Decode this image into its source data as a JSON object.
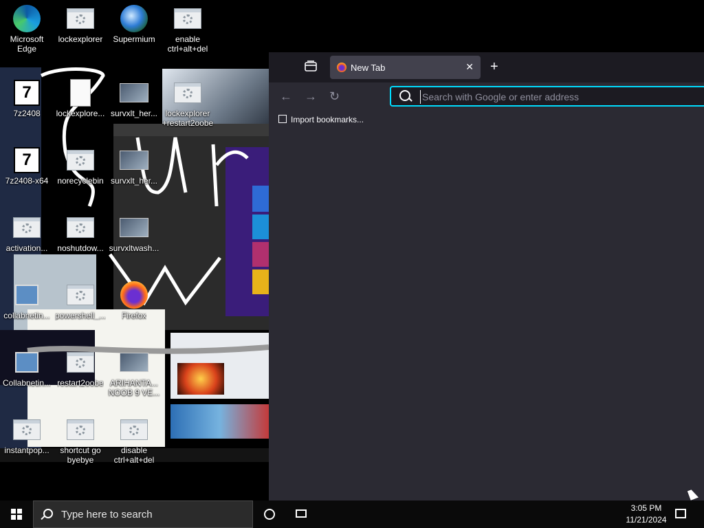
{
  "desktop": {
    "icons": [
      {
        "label": "Microsoft Edge"
      },
      {
        "label": "lockexplorer"
      },
      {
        "label": "Supermium"
      },
      {
        "label": "enable ctrl+alt+del"
      },
      {
        "label": "7z2408"
      },
      {
        "label": "lockexplore..."
      },
      {
        "label": "survxlt_her..."
      },
      {
        "label": "lockexplorer +restart2oobe"
      },
      {
        "label": "7z2408-x64"
      },
      {
        "label": "norecyclebin"
      },
      {
        "label": "survxlt_her..."
      },
      {
        "label": "activation..."
      },
      {
        "label": "noshutdow..."
      },
      {
        "label": "survxltwash..."
      },
      {
        "label": "collabnetin..."
      },
      {
        "label": "powershell_..."
      },
      {
        "label": "Firefox"
      },
      {
        "label": "Collabnetin..."
      },
      {
        "label": "restart2oobe"
      },
      {
        "label": "ARIHANTA... NOOB 9 VE..."
      },
      {
        "label": "instantpop..."
      },
      {
        "label": "shortcut go byebye"
      },
      {
        "label": "disable ctrl+alt+del"
      }
    ]
  },
  "browser": {
    "tab_title": "New Tab",
    "tab_close": "✕",
    "new_tab": "+",
    "nav_back": "←",
    "nav_forward": "→",
    "nav_reload": "↻",
    "address_placeholder": "Search with Google or enter address",
    "address_value": "",
    "bookmark_import": "Import bookmarks..."
  },
  "taskbar": {
    "search_placeholder": "Type here to search",
    "time": "3:05 PM",
    "date": "11/21/2024"
  }
}
